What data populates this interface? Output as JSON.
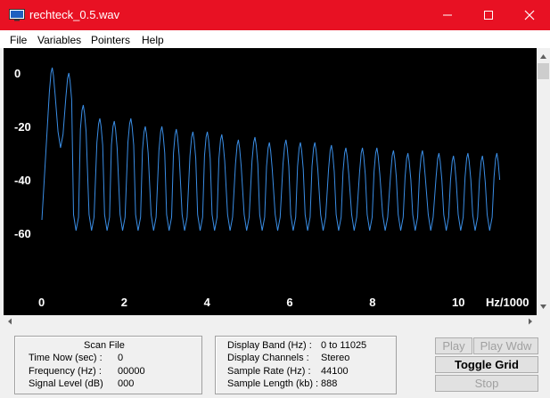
{
  "window": {
    "title": "rechteck_0.5.wav"
  },
  "menu": [
    "File",
    "Variables",
    "Pointers",
    "Help"
  ],
  "chart_data": {
    "type": "line",
    "xlabel": "Hz/1000",
    "x_ticks": [
      "0",
      "2",
      "4",
      "6",
      "8",
      "10"
    ],
    "y_ticks": [
      "0",
      "-20",
      "-40",
      "-60"
    ],
    "xlim": [
      0,
      11.025
    ],
    "ylim": [
      -60,
      4
    ],
    "grid": false,
    "line_color": "#3a8ee6",
    "peaks": [
      {
        "x": 0.25,
        "y": 2
      },
      {
        "x": 0.65,
        "y": 0
      },
      {
        "x": 1.0,
        "y": -12
      },
      {
        "x": 1.4,
        "y": -17
      },
      {
        "x": 1.75,
        "y": -18
      },
      {
        "x": 2.15,
        "y": -17
      },
      {
        "x": 2.5,
        "y": -20
      },
      {
        "x": 2.9,
        "y": -20
      },
      {
        "x": 3.25,
        "y": -21
      },
      {
        "x": 3.65,
        "y": -22
      },
      {
        "x": 4.0,
        "y": -22
      },
      {
        "x": 4.35,
        "y": -23
      },
      {
        "x": 4.75,
        "y": -25
      },
      {
        "x": 5.15,
        "y": -24
      },
      {
        "x": 5.5,
        "y": -26
      },
      {
        "x": 5.9,
        "y": -25
      },
      {
        "x": 6.25,
        "y": -26
      },
      {
        "x": 6.6,
        "y": -26
      },
      {
        "x": 7.0,
        "y": -27
      },
      {
        "x": 7.35,
        "y": -28
      },
      {
        "x": 7.75,
        "y": -28
      },
      {
        "x": 8.1,
        "y": -28
      },
      {
        "x": 8.5,
        "y": -29
      },
      {
        "x": 8.85,
        "y": -30
      },
      {
        "x": 9.2,
        "y": -29
      },
      {
        "x": 9.6,
        "y": -30
      },
      {
        "x": 9.95,
        "y": -31
      },
      {
        "x": 10.3,
        "y": -30
      },
      {
        "x": 10.65,
        "y": -31
      },
      {
        "x": 11.0,
        "y": -30
      }
    ]
  },
  "status": {
    "scan_title": "Scan File",
    "time_label": "Time Now (sec) :",
    "time_value": "0",
    "freq_label": "Frequency (Hz) :",
    "freq_value": "00000",
    "level_label": "Signal Level (dB)",
    "level_value": "000",
    "band_label": "Display Band (Hz) :",
    "band_value": "0 to 11025",
    "channels_label": "Display Channels :",
    "channels_value": "Stereo",
    "rate_label": "Sample Rate (Hz) :",
    "rate_value": "44100",
    "length_label": "Sample Length (kb) :",
    "length_value": "888"
  },
  "buttons": {
    "play": "Play",
    "play_wdw": "Play Wdw",
    "toggle_grid": "Toggle Grid",
    "stop": "Stop"
  }
}
